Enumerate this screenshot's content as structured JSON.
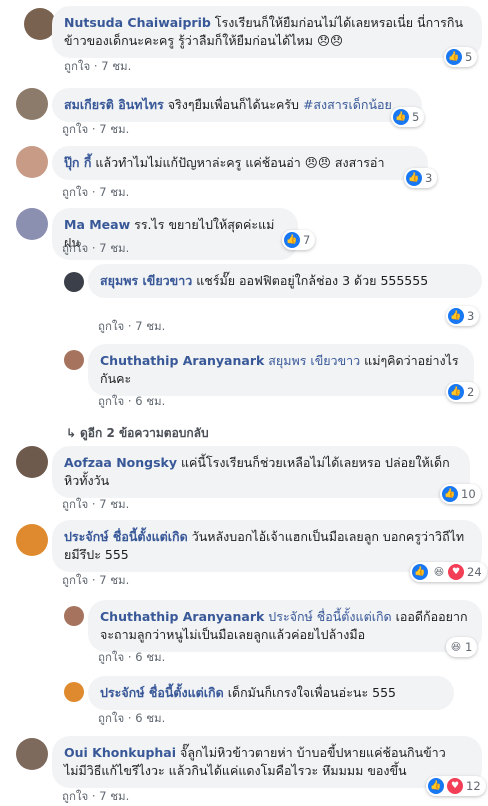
{
  "like_label": "ถูกใจ",
  "comments": [
    {
      "name": "Nutsuda Chaiwaiprib",
      "text": " โรงเรียนก็ให้ยืมก่อนไม่ได้เลยหรอเนี่ย นี่การกินข้าวของเด็กนะคะครู รู้ว่าลืมก็ให้ยืมก่อนได้ไหม 😞😞",
      "time": "7 ชม.",
      "count": "5"
    },
    {
      "name": "สมเกียรติ อินทไทร",
      "text": " จริงๆยืมเพื่อนก็ได้นะครับ ",
      "tag": "#สงสารเด็กน้อย",
      "time": "7 ชม.",
      "count": "5"
    },
    {
      "name": "ปุ๊ก กี้",
      "text": " แล้วทำไมไม่แก้ปัญหาล่ะครู แค่ช้อนอ่า 😠😠 สงสารอ่า",
      "time": "7 ชม.",
      "count": "3"
    },
    {
      "name": "Ma Meaw",
      "text": " รร.ไร ขยายไปให้สุดค่ะแม่ฝน",
      "time": "7 ชม.",
      "count": "7"
    },
    {
      "name": "สยุมพร เขียวขาว",
      "text": " แชร์มั๊ย ออฟฟิตอยู่ใกล้ช่อง 3 ด้วย 555555",
      "time": "7 ชม.",
      "count": "3"
    },
    {
      "name": "Chuthathip Aranyanark",
      "tag": "สยุมพร เขียวขาว",
      "text": " แม่ๆคิดว่าอย่างไรกันคะ",
      "time": "6 ชม.",
      "count": "2"
    },
    {
      "name": "Aofzaa Nongsky",
      "text": " แค่นี้โรงเรียนก็ช่วยเหลือไม่ได้เลยหรอ ปล่อยให้เด็กหิวทั้งวัน",
      "time": "7 ชม.",
      "count": "10"
    },
    {
      "name": "ประจักษ์ ชื่อนี้ตั้งแต่เกิด",
      "text": " วันหลังบอกไอ้เจ้าแฮกเป็นมือเลยลูก บอกครูว่าวิถีไทยมีรึปะ 555",
      "time": "7 ชม.",
      "count": "24"
    },
    {
      "name": "Chuthathip Aranyanark",
      "tag": "ประจักษ์ ชื่อนี้ตั้งแต่เกิด",
      "text": " เออดีก้ออยากจะถามลูกว่าหนูไม่เป็นมือเลยลูกแล้วค่อยไปล้างมือ",
      "time": "6 ชม.",
      "count": "1"
    },
    {
      "name": "ประจักษ์ ชื่อนี้ตั้งแต่เกิด",
      "text": " เด็กมันก็เกรงใจเพื่อนอ่ะนะ 555",
      "time": "6 ชม.",
      "count": ""
    },
    {
      "name": "Oui Khonkuphai",
      "text": " จั๊ลูกไม่หิวข้าวตายห่า บ้าบอขี้ปหายแค่ช้อนกินข้าว ไม่มีวิธีแก้ไขรึไงวะ แล้วกินได้แค่แดงโมคือไรวะ หึมมมม ของขึ้น",
      "time": "7 ชม.",
      "count": "12"
    }
  ],
  "more_replies": "ดูอีก 2 ข้อความตอบกลับ",
  "colors": {
    "link": "#385898",
    "bubble": "#f2f3f5",
    "like": "#1877f2"
  }
}
